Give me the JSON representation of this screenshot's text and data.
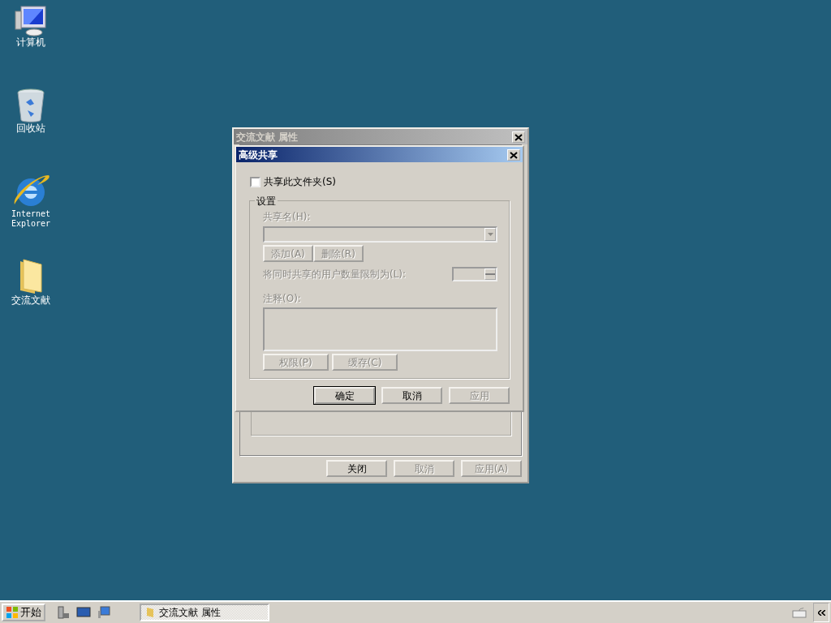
{
  "desktop_icons": [
    {
      "label": "计算机",
      "kind": "computer"
    },
    {
      "label": "回收站",
      "kind": "recycle"
    },
    {
      "label": "Internet Explorer",
      "kind": "browser"
    },
    {
      "label": "交流文献",
      "kind": "folder"
    }
  ],
  "properties_window": {
    "title": "交流文献 属性",
    "active": false,
    "buttons": [
      {
        "label": "关闭",
        "disabled": false
      },
      {
        "label": "取消",
        "disabled": true
      },
      {
        "label": "应用(A)",
        "disabled": true
      }
    ]
  },
  "advanced_sharing": {
    "title": "高级共享",
    "active": true,
    "share_checkbox": {
      "label": "共享此文件夹(S)",
      "checked": false
    },
    "settings_group": {
      "title": "设置",
      "disabled": true,
      "share_name_label": "共享名(H):",
      "add_button": "添加(A)",
      "remove_button": "删除(R)",
      "limit_label": "将同时共享的用户数量限制为(L):",
      "comment_label": "注释(O):",
      "permissions_button": "权限(P)",
      "caching_button": "缓存(C)"
    },
    "buttons": [
      {
        "label": "确定",
        "disabled": false,
        "default": true
      },
      {
        "label": "取消",
        "disabled": false,
        "default": false
      },
      {
        "label": "应用",
        "disabled": true,
        "default": false
      }
    ]
  },
  "taskbar": {
    "start_label": "开始",
    "tasks": [
      {
        "label": "交流文献 属性",
        "selected": true
      }
    ]
  }
}
